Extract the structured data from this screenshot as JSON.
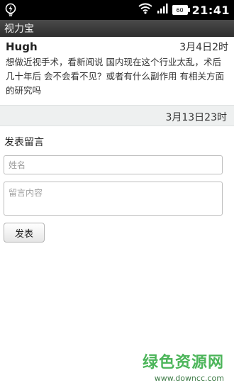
{
  "status_bar": {
    "time": "21:41",
    "battery": "60"
  },
  "app": {
    "title": "视力宝"
  },
  "comment": {
    "author": "Hugh",
    "time": "3月4日2时",
    "text": "想做近视手术，看新闻说 国内现在这个行业太乱，术后几十年后 会不会看不见？或者有什么副作用 有相关方面的研究吗",
    "reply_time": "3月13日23时"
  },
  "form": {
    "title": "发表留言",
    "name_placeholder": "姓名",
    "content_placeholder": "留言内容",
    "submit_label": "发表"
  },
  "watermark": {
    "title": "绿色资源网",
    "url": "www.downcc.com"
  }
}
